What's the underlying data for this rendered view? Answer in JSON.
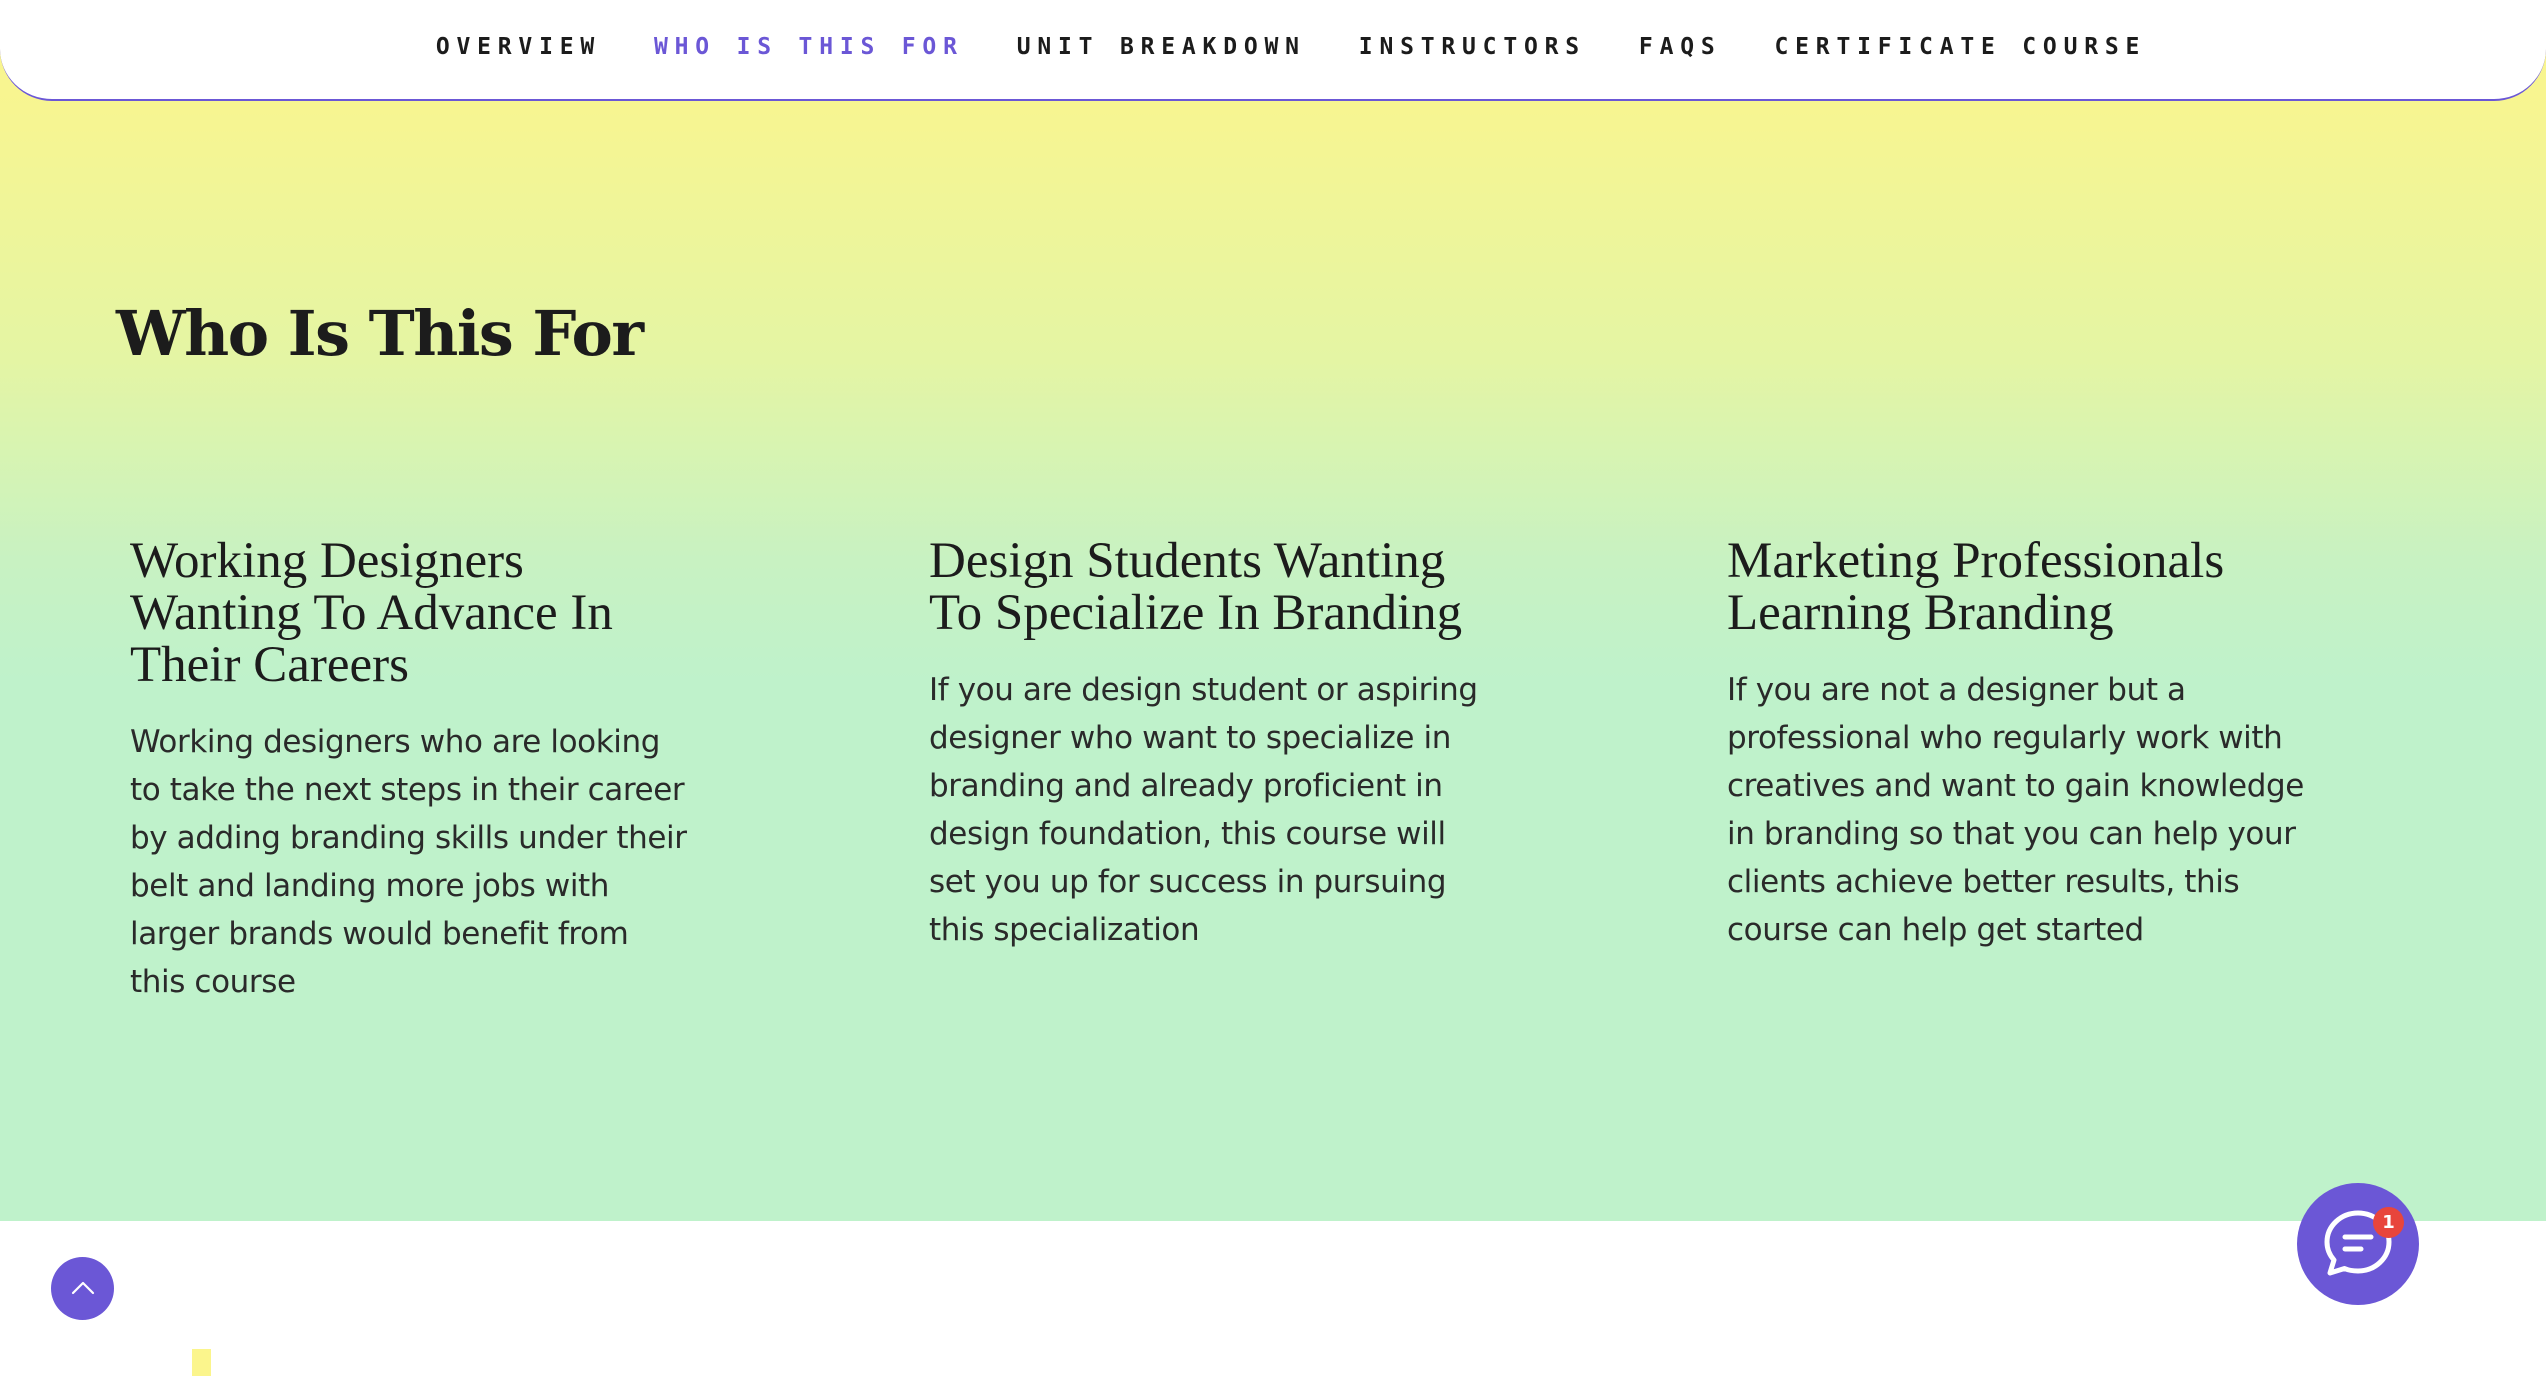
{
  "nav": {
    "items": [
      {
        "label": "OVERVIEW",
        "active": false
      },
      {
        "label": "WHO IS THIS FOR",
        "active": true
      },
      {
        "label": "UNIT BREAKDOWN",
        "active": false
      },
      {
        "label": "INSTRUCTORS",
        "active": false
      },
      {
        "label": "FAQS",
        "active": false
      },
      {
        "label": "CERTIFICATE COURSE",
        "active": false
      }
    ]
  },
  "section": {
    "title": "Who Is This For",
    "cards": [
      {
        "title": "Working Designers Wanting To Advance In Their Careers",
        "body": "Working designers who are looking to take the next steps in their career by adding branding skills under their belt and landing more jobs with larger brands would benefit from this course"
      },
      {
        "title": "Design Students Wanting To Specialize In Branding",
        "body": "If you are design student or aspiring designer who want to specialize in branding and already proficient in design foundation, this course will set you up for success in pursuing this specialization"
      },
      {
        "title": "Marketing Professionals Learning Branding",
        "body": "If you are not a designer but a professional who regularly work with creatives and want to gain knowledge in branding so that you can help your clients achieve better results, this course can help get started"
      }
    ]
  },
  "chat": {
    "badge_count": "1",
    "icon": "chat-bubble-icon"
  },
  "scroll_top": {
    "icon": "chevron-up-icon"
  },
  "colors": {
    "accent": "#6b57d6",
    "badge": "#e8453c",
    "gradient_top": "#fbf58c",
    "gradient_bottom": "#bff2cb"
  }
}
